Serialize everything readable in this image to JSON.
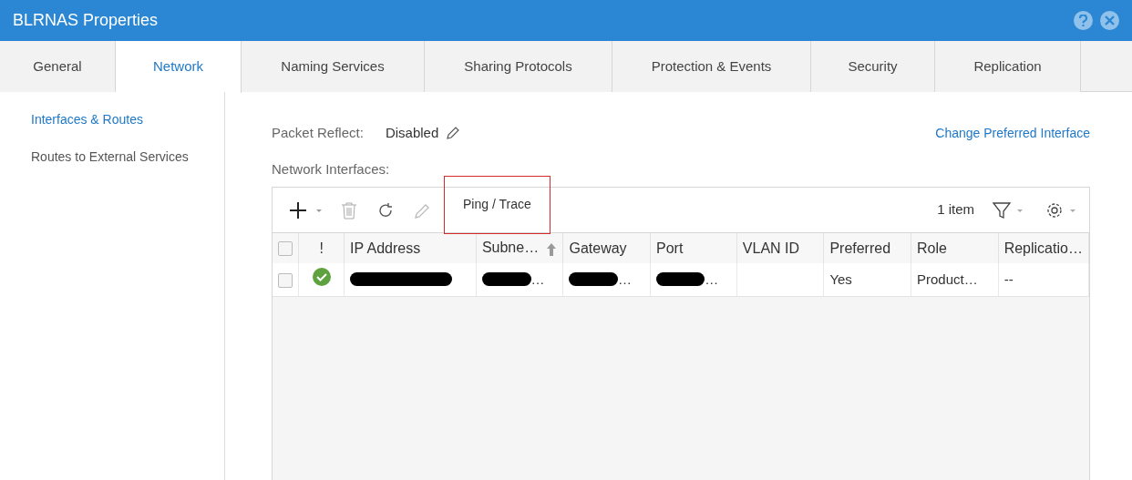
{
  "window": {
    "title": "BLRNAS Properties"
  },
  "tabs": [
    {
      "label": "General",
      "selected": false
    },
    {
      "label": "Network",
      "selected": true
    },
    {
      "label": "Naming Services",
      "selected": false
    },
    {
      "label": "Sharing Protocols",
      "selected": false
    },
    {
      "label": "Protection & Events",
      "selected": false
    },
    {
      "label": "Security",
      "selected": false
    },
    {
      "label": "Replication",
      "selected": false
    }
  ],
  "sidebar": {
    "items": [
      {
        "label": "Interfaces & Routes",
        "selected": true
      },
      {
        "label": "Routes to External Services",
        "selected": false
      }
    ]
  },
  "packet_reflect": {
    "label": "Packet Reflect:",
    "value": "Disabled"
  },
  "change_link": "Change Preferred Interface",
  "section_label": "Network Interfaces:",
  "toolbar": {
    "ping_button": {
      "label": "Ping / Trace",
      "highlighted": true
    },
    "count": "1 item"
  },
  "table": {
    "all_checked": false,
    "columns": [
      {
        "label": "!"
      },
      {
        "label": "IP Address"
      },
      {
        "label": "Subne…",
        "sorted": true
      },
      {
        "label": "Gateway"
      },
      {
        "label": "Port"
      },
      {
        "label": "VLAN ID"
      },
      {
        "label": "Preferred"
      },
      {
        "label": "Role"
      },
      {
        "label": "Replicatio…"
      }
    ],
    "rows": [
      {
        "checked": false,
        "cells": [
          {
            "kind": "status",
            "ok": true
          },
          {
            "redacted": true
          },
          {
            "redacted": true,
            "text": "…"
          },
          {
            "redacted": true,
            "text": "…"
          },
          {
            "redacted": true,
            "text": "…"
          },
          {
            "text": ""
          },
          {
            "text": "Yes"
          },
          {
            "text": "Product…"
          },
          {
            "text": "--"
          }
        ]
      }
    ]
  }
}
